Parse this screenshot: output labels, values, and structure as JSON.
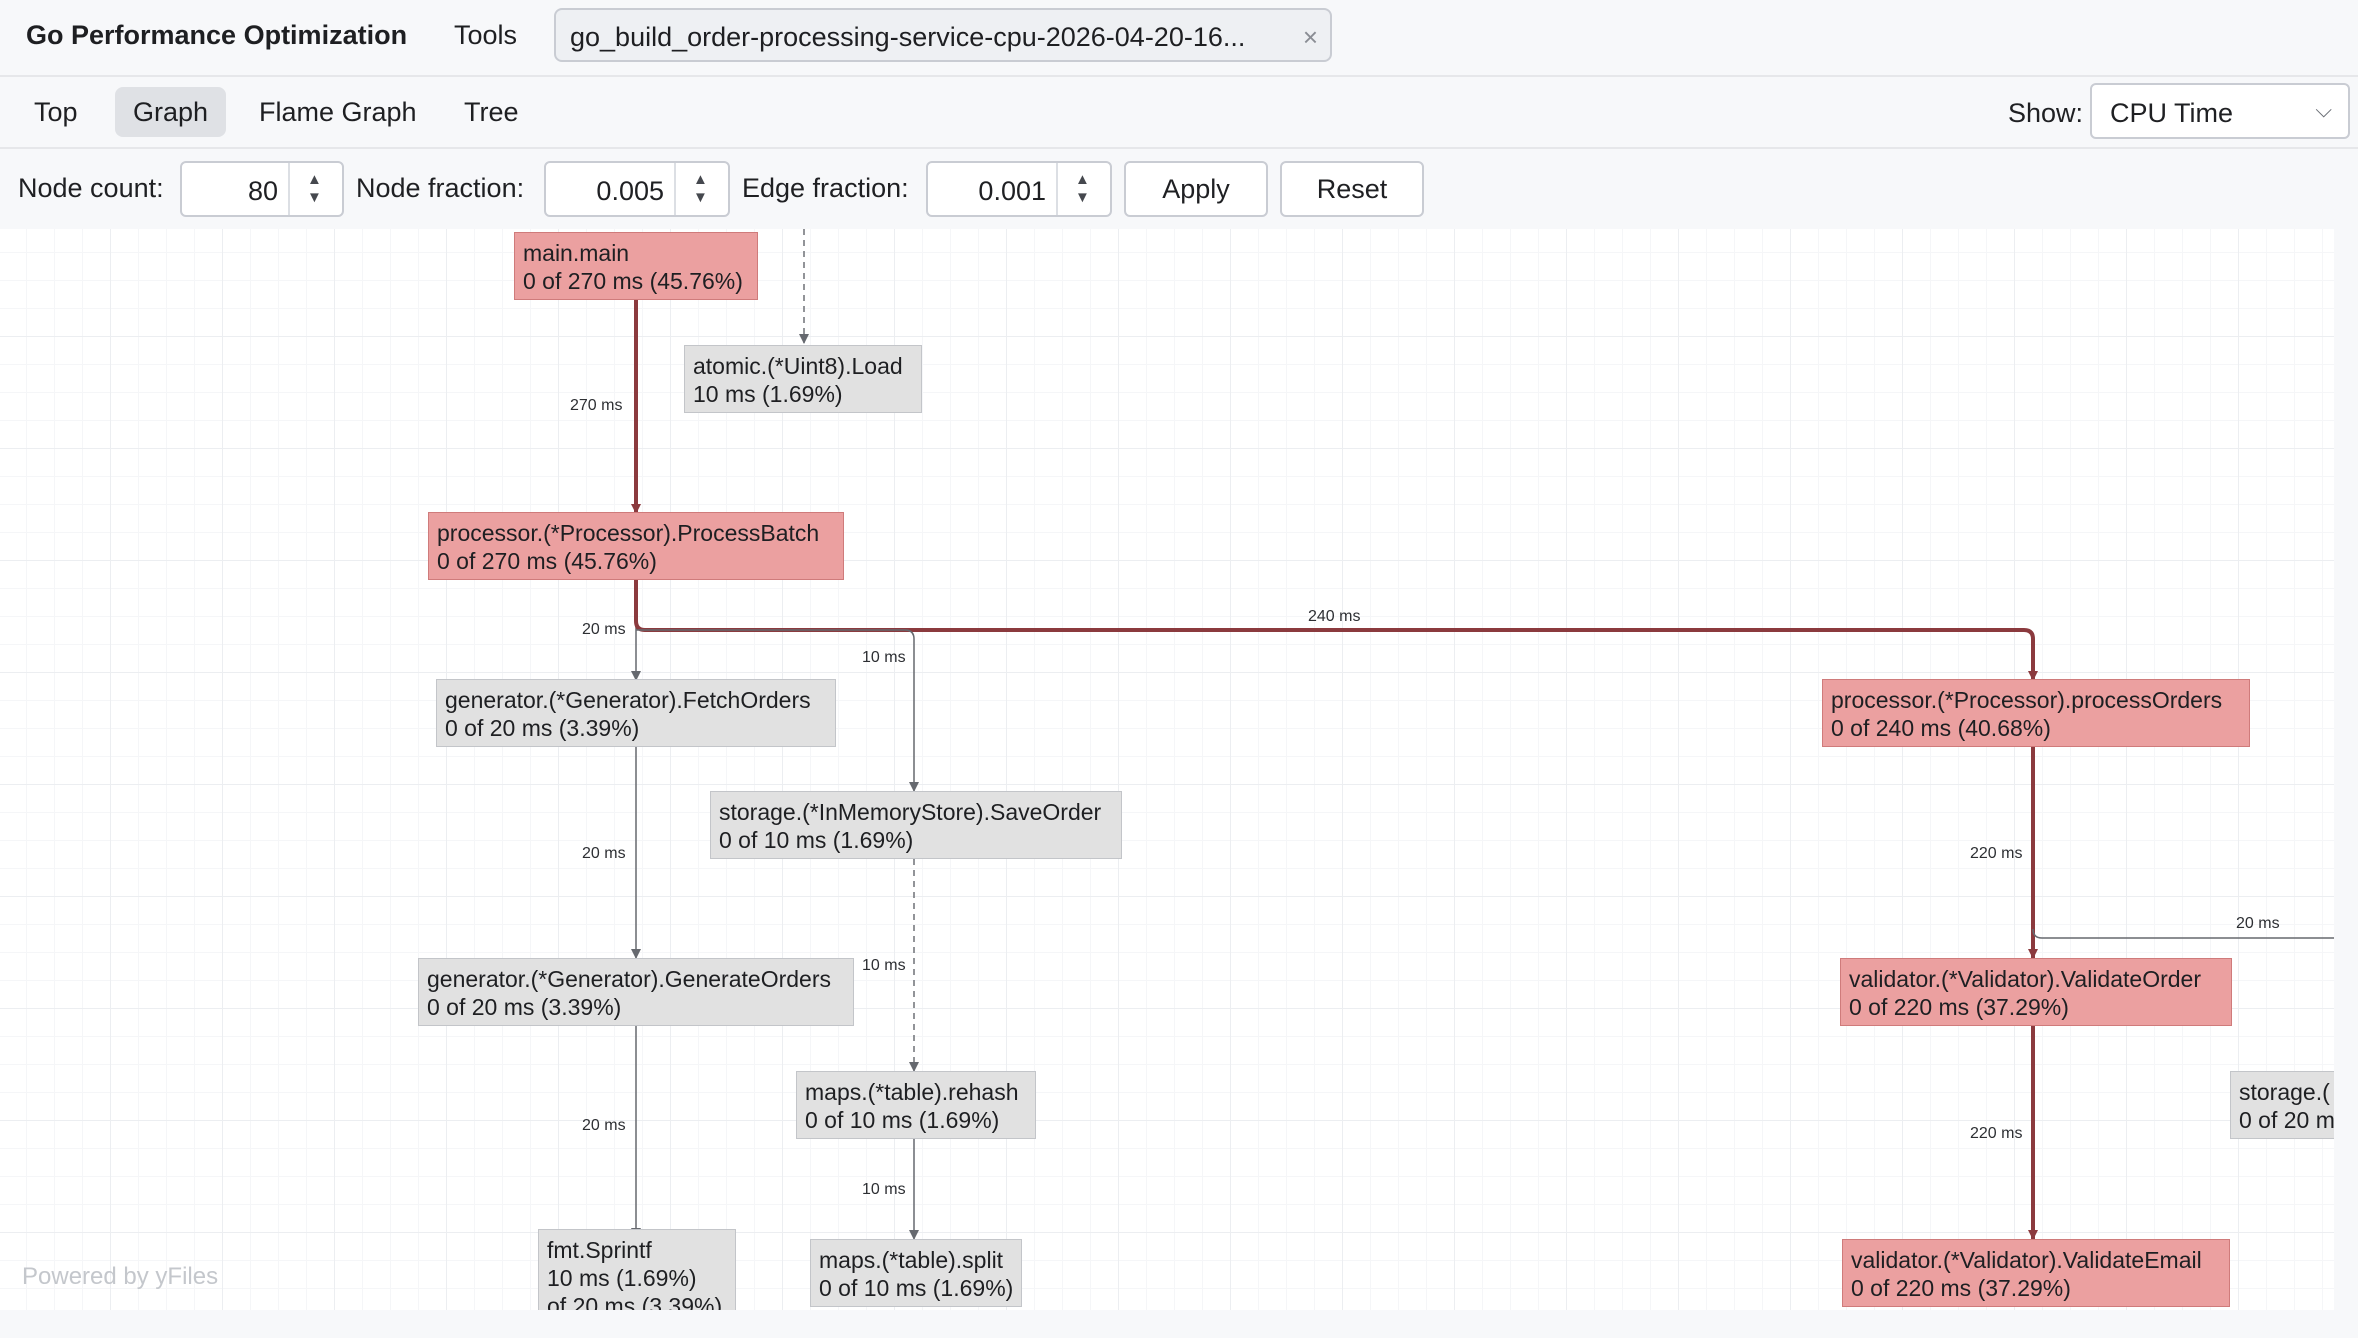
{
  "header": {
    "app_title": "Go Performance Optimization",
    "menu_tools": "Tools",
    "file_tab": "go_build_order-processing-service-cpu-2026-04-20-16...",
    "close_glyph": "×"
  },
  "views": {
    "tabs": [
      {
        "label": "Top",
        "active": false
      },
      {
        "label": "Graph",
        "active": true
      },
      {
        "label": "Flame Graph",
        "active": false
      },
      {
        "label": "Tree",
        "active": false
      }
    ],
    "show_label": "Show:",
    "show_value": "CPU Time",
    "chevron_glyph": "⌵"
  },
  "params": {
    "node_count_label": "Node count:",
    "node_count_value": "80",
    "node_fraction_label": "Node fraction:",
    "node_fraction_value": "0.005",
    "edge_fraction_label": "Edge fraction:",
    "edge_fraction_value": "0.001",
    "apply_label": "Apply",
    "reset_label": "Reset",
    "up_glyph": "▲",
    "down_glyph": "▼"
  },
  "graph": {
    "watermark": "Powered by yFiles",
    "hot_color": "#eba0a0",
    "cold_color": "#e1e1e1",
    "hot_edge_color": "#8b3a3e",
    "nodes": {
      "main_main": {
        "name": "main.main",
        "stat": "0 of 270 ms (45.76%)"
      },
      "atomic_load": {
        "name": "atomic.(*Uint8).Load",
        "stat": "10 ms (1.69%)"
      },
      "process_batch": {
        "name": "processor.(*Processor).ProcessBatch",
        "stat": "0 of 270 ms (45.76%)"
      },
      "fetch_orders": {
        "name": "generator.(*Generator).FetchOrders",
        "stat": "0 of 20 ms (3.39%)"
      },
      "save_order": {
        "name": "storage.(*InMemoryStore).SaveOrder",
        "stat": "0 of 10 ms (1.69%)"
      },
      "process_orders": {
        "name": "processor.(*Processor).processOrders",
        "stat": "0 of 240 ms (40.68%)"
      },
      "generate_orders": {
        "name": "generator.(*Generator).GenerateOrders",
        "stat": "0 of 20 ms (3.39%)"
      },
      "validate_order": {
        "name": "validator.(*Validator).ValidateOrder",
        "stat": "0 of 220 ms (37.29%)"
      },
      "rehash": {
        "name": "maps.(*table).rehash",
        "stat": "0 of 10 ms (1.69%)"
      },
      "storage_partial": {
        "name": "storage.(",
        "stat": "0 of 20 m"
      },
      "sprintf": {
        "name": "fmt.Sprintf",
        "stat": "10 ms (1.69%)",
        "stat2": "of 20 ms (3.39%)"
      },
      "split": {
        "name": "maps.(*table).split",
        "stat": "0 of 10 ms (1.69%)"
      },
      "validate_email": {
        "name": "validator.(*Validator).ValidateEmail",
        "stat": "0 of 220 ms (37.29%)"
      }
    },
    "edges": {
      "e1": "270 ms",
      "e2": "20 ms",
      "e3": "240 ms",
      "e4": "10 ms",
      "e5": "20 ms",
      "e6": "10 ms",
      "e7": "220 ms",
      "e8": "20 ms",
      "e9": "20 ms",
      "e10": "10 ms",
      "e11": "220 ms"
    }
  }
}
